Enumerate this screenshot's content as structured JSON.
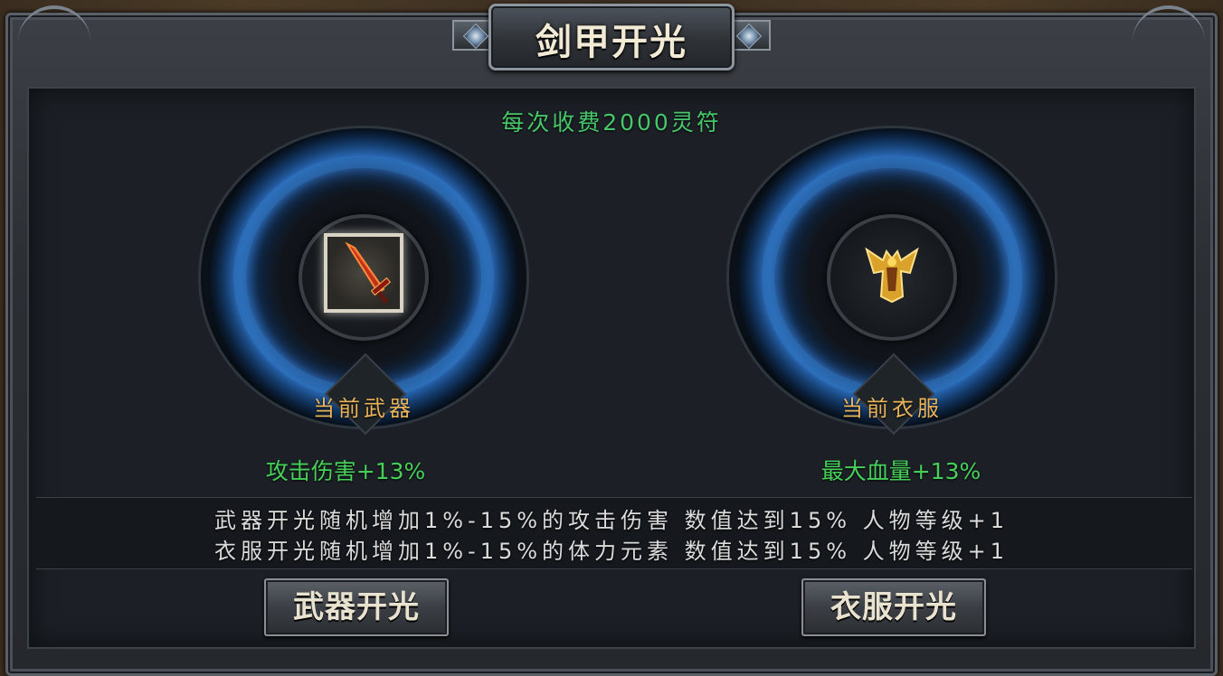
{
  "window": {
    "title": "剑甲开光"
  },
  "fee_text": "每次收费2000灵符",
  "weapon": {
    "label": "当前武器",
    "stat": "攻击伤害+13%",
    "icon": "red-sword-icon"
  },
  "armor": {
    "label": "当前衣服",
    "stat": "最大血量+13%",
    "icon": "golden-armor-icon"
  },
  "description": [
    "武器开光随机增加1%-15%的攻击伤害 数值达到15% 人物等级+1",
    "衣服开光随机增加1%-15%的体力元素 数值达到15% 人物等级+1"
  ],
  "buttons": {
    "weapon": "武器开光",
    "armor": "衣服开光"
  },
  "colors": {
    "fee": "#46c86a",
    "stat": "#46d05a",
    "item_label": "#e9b35a",
    "ring_glow": "#3c8ce6"
  }
}
